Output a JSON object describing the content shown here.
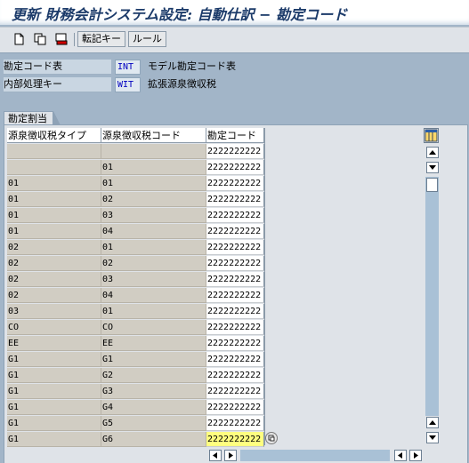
{
  "window": {
    "title": "更新 財務会計システム設定: 自動仕訳 − 勘定コード"
  },
  "toolbar": {
    "transfer_key_label": "転記キー",
    "rules_label": "ルール"
  },
  "fields": [
    {
      "label": "勘定コード表",
      "value": "INT",
      "description": "モデル勘定コード表"
    },
    {
      "label": "内部処理キー",
      "value": "WIT",
      "description": "拡張源泉徴収税"
    }
  ],
  "assignment": {
    "tab_label": "勘定割当",
    "columns": [
      "源泉徴収税タイプ",
      "源泉徴収税コード",
      "勘定コード"
    ],
    "rows": [
      [
        "",
        "",
        "2222222222"
      ],
      [
        "",
        "01",
        "2222222222"
      ],
      [
        "01",
        "01",
        "2222222222"
      ],
      [
        "01",
        "02",
        "2222222222"
      ],
      [
        "01",
        "03",
        "2222222222"
      ],
      [
        "01",
        "04",
        "2222222222"
      ],
      [
        "02",
        "01",
        "2222222222"
      ],
      [
        "02",
        "02",
        "2222222222"
      ],
      [
        "02",
        "03",
        "2222222222"
      ],
      [
        "02",
        "04",
        "2222222222"
      ],
      [
        "03",
        "01",
        "2222222222"
      ],
      [
        "CO",
        "CO",
        "2222222222"
      ],
      [
        "EE",
        "EE",
        "2222222222"
      ],
      [
        "G1",
        "G1",
        "2222222222"
      ],
      [
        "G1",
        "G2",
        "2222222222"
      ],
      [
        "G1",
        "G3",
        "2222222222"
      ],
      [
        "G1",
        "G4",
        "2222222222"
      ],
      [
        "G1",
        "G5",
        "2222222222"
      ],
      [
        "G1",
        "G6",
        "2222222222"
      ]
    ],
    "active_row": 18,
    "active_col": 2
  },
  "icons": {
    "new": "new-document-icon",
    "copy": "copy-icon",
    "delete": "delete-icon",
    "config": "table-settings-icon",
    "f4": "value-help-icon"
  },
  "colors": {
    "title": "#1c3b6a",
    "field_value": "#0000c0",
    "active_cell": "#ffff80"
  }
}
